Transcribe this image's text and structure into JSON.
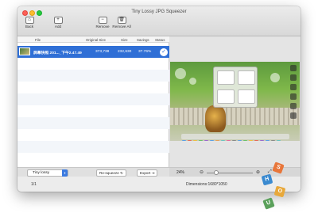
{
  "window": {
    "title": "Tiny Lossy JPG Squeezer"
  },
  "toolbar": {
    "back_label": "Back",
    "add_label": "Add",
    "remove_label": "Remove",
    "remove_all_label": "Remove All"
  },
  "table": {
    "columns": [
      "File",
      "Original Size",
      "Size",
      "Savings",
      "Status"
    ],
    "rows": [
      {
        "file": "屏幕快照 201..._下午2.47.49",
        "original_size": "373,738",
        "size": "232,630",
        "savings": "37.76%",
        "status": "done"
      }
    ]
  },
  "controls": {
    "quality_value": "Tiny lossy",
    "requeue_label": "Re-squeeze",
    "export_label": "Export",
    "zoom_percent": "24%",
    "zoom_level_fraction": 0.24
  },
  "status": {
    "count": "1/1",
    "dimensions": "Dimensions:1680*1050"
  },
  "watermark": {
    "letters": [
      "S",
      "H",
      "O",
      "U"
    ]
  },
  "colors": {
    "selection": "#2f6fd6",
    "accent": "#3b7ae0"
  }
}
